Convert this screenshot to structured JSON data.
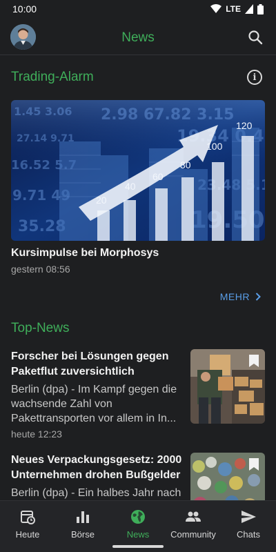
{
  "status": {
    "time": "10:00",
    "network": "LTE"
  },
  "header": {
    "title": "News",
    "avatar": "user-avatar",
    "search_icon": "search-icon"
  },
  "trading_alarm": {
    "section_title": "Trading-Alarm",
    "info_icon": "info-icon",
    "image_labels": [
      "20",
      "40",
      "60",
      "80",
      "100",
      "120"
    ],
    "headline": "Kursimpulse bei Morphosys",
    "time": "gestern 08:56",
    "more_label": "MEHR"
  },
  "top_news": {
    "section_title": "Top-News",
    "items": [
      {
        "title": "Forscher bei Lösungen gegen Paketflut zuversichtlich",
        "body": "Berlin (dpa) - Im Kampf gegen die wachsende Zahl von Pakettransporten vor allem in In...",
        "time": "heute 12:23"
      },
      {
        "title": "Neues Verpackungsgesetz: 2000 Unternehmen drohen Bußgelder",
        "body": "Berlin (dpa) - Ein halbes Jahr nach Inkrafttreten des",
        "time": ""
      }
    ]
  },
  "bottom_nav": {
    "items": [
      {
        "label": "Heute",
        "icon": "calendar-clock-icon",
        "active": false
      },
      {
        "label": "Börse",
        "icon": "bar-chart-icon",
        "active": false
      },
      {
        "label": "News",
        "icon": "globe-icon",
        "active": true
      },
      {
        "label": "Community",
        "icon": "people-icon",
        "active": false
      },
      {
        "label": "Chats",
        "icon": "send-icon",
        "active": false
      }
    ]
  },
  "colors": {
    "accent": "#3fae5a",
    "link": "#5a9ee8",
    "background": "#1e1f21"
  }
}
